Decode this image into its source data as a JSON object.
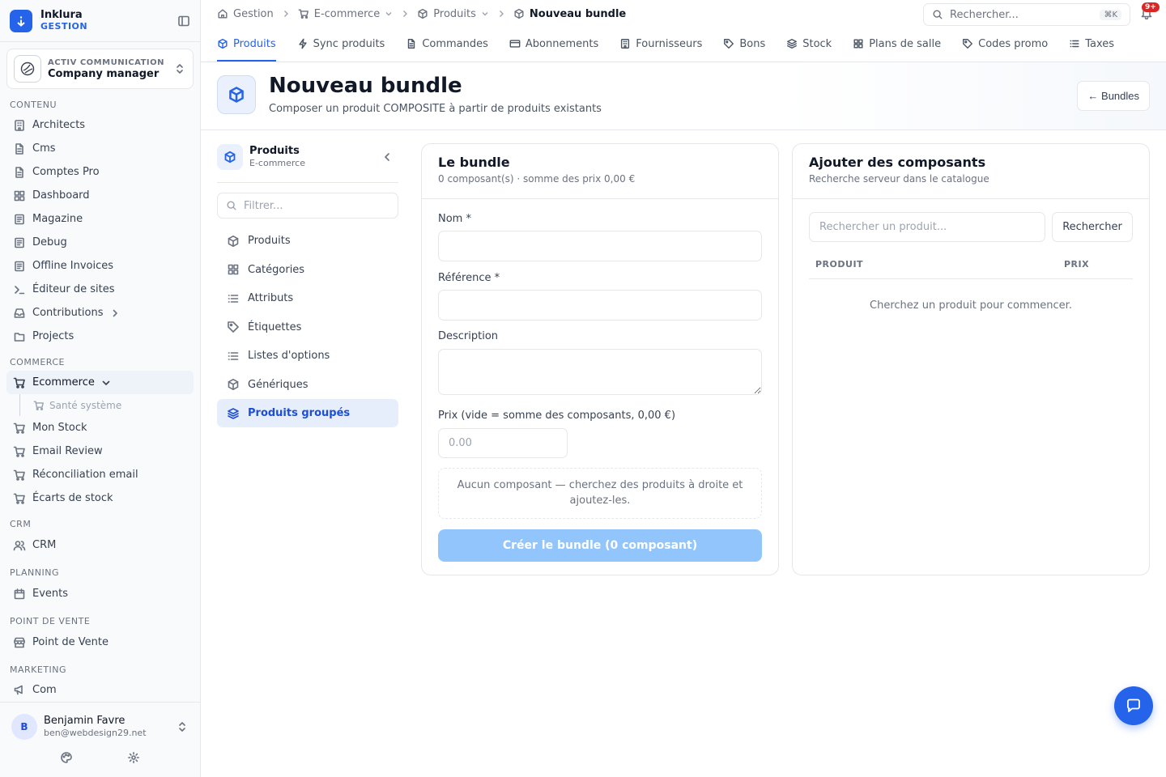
{
  "brand": {
    "name": "Inklura",
    "sub": "GESTION"
  },
  "org": {
    "label": "ACTIV COMMUNICATION",
    "name": "Company manager"
  },
  "sidebar": {
    "sections": [
      {
        "title": "CONTENU",
        "items": [
          {
            "label": "Architects",
            "icon": "building-icon"
          },
          {
            "label": "Cms",
            "icon": "document-icon"
          },
          {
            "label": "Comptes Pro",
            "icon": "document-icon"
          },
          {
            "label": "Dashboard",
            "icon": "grid-icon"
          },
          {
            "label": "Magazine",
            "icon": "newspaper-icon"
          },
          {
            "label": "Debug",
            "icon": "newspaper-icon"
          },
          {
            "label": "Offline Invoices",
            "icon": "newspaper-icon"
          },
          {
            "label": "Éditeur de sites",
            "icon": "terminal-icon"
          },
          {
            "label": "Contributions",
            "icon": "inbox-icon"
          },
          {
            "label": "Projects",
            "icon": "folder-icon"
          }
        ]
      },
      {
        "title": "COMMERCE",
        "items": [
          {
            "label": "Ecommerce",
            "icon": "cart-icon"
          },
          {
            "label": "Santé système",
            "icon": "cart-icon"
          },
          {
            "label": "Mon Stock",
            "icon": "cart-icon"
          },
          {
            "label": "Email Review",
            "icon": "cart-icon"
          },
          {
            "label": "Réconciliation email",
            "icon": "cart-icon"
          },
          {
            "label": "Écarts de stock",
            "icon": "cart-icon"
          }
        ]
      },
      {
        "title": "CRM",
        "items": [
          {
            "label": "CRM",
            "icon": "users-icon"
          }
        ]
      },
      {
        "title": "PLANNING",
        "items": [
          {
            "label": "Events",
            "icon": "calendar-icon"
          }
        ]
      },
      {
        "title": "POINT DE VENTE",
        "items": [
          {
            "label": "Point de Vente",
            "icon": "store-icon"
          }
        ]
      },
      {
        "title": "MARKETING",
        "items": [
          {
            "label": "Com",
            "icon": "megaphone-icon"
          }
        ]
      }
    ]
  },
  "user": {
    "initial": "B",
    "name": "Benjamin Favre",
    "email": "ben@webdesign29.net"
  },
  "breadcrumb": {
    "items": [
      "Gestion",
      "E-commerce",
      "Produits",
      "Nouveau bundle"
    ]
  },
  "topsearch": {
    "placeholder": "Rechercher...",
    "shortcut": "⌘K"
  },
  "notifications": {
    "badge": "9+"
  },
  "tabs": [
    "Produits",
    "Sync produits",
    "Commandes",
    "Abonnements",
    "Fournisseurs",
    "Bons",
    "Stock",
    "Plans de salle",
    "Codes promo",
    "Taxes"
  ],
  "header": {
    "title": "Nouveau bundle",
    "subtitle": "Composer un produit COMPOSITE à partir de produits existants",
    "back_label": "← Bundles"
  },
  "subnav": {
    "title": "Produits",
    "subtitle": "E-commerce",
    "filter_placeholder": "Filtrer...",
    "items": [
      "Produits",
      "Catégories",
      "Attributs",
      "Étiquettes",
      "Listes d'options",
      "Génériques",
      "Produits groupés"
    ]
  },
  "bundle_card": {
    "title": "Le bundle",
    "subtitle": "0 composant(s) · somme des prix 0,00 €",
    "name_label": "Nom *",
    "ref_label": "Référence *",
    "desc_label": "Description",
    "price_label": "Prix (vide = somme des composants, 0,00 €)",
    "price_placeholder": "0.00",
    "empty_text": "Aucun composant — cherchez des produits à droite et ajoutez-les.",
    "submit_label": "Créer le bundle (0 composant)"
  },
  "components_card": {
    "title": "Ajouter des composants",
    "subtitle": "Recherche serveur dans le catalogue",
    "search_placeholder": "Rechercher un produit...",
    "search_button": "Rechercher",
    "columns": [
      "PRODUIT",
      "PRIX"
    ],
    "empty_text": "Cherchez un produit pour commencer."
  },
  "colors": {
    "accent": "#2563eb",
    "disabled_button": "#93c5fd",
    "badge": "#dc2626"
  }
}
